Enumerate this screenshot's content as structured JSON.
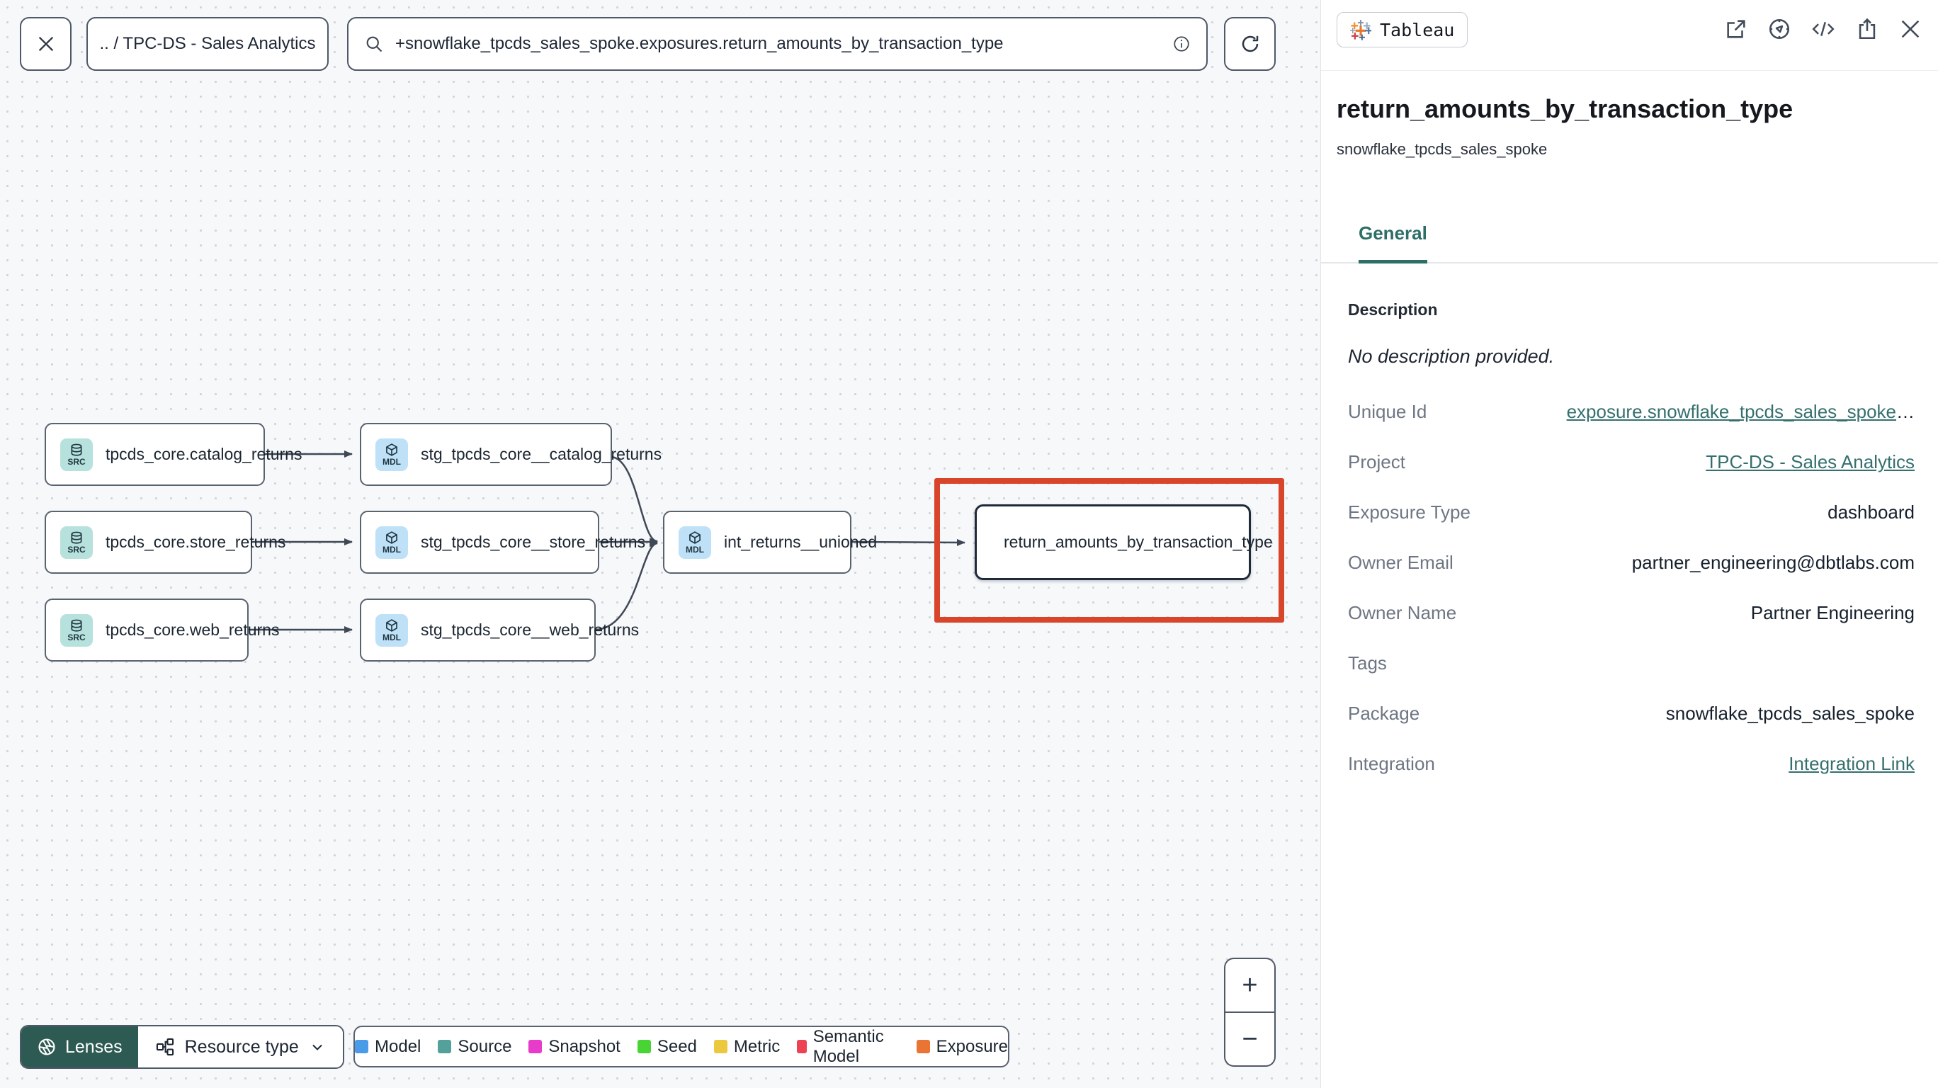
{
  "toolbar": {
    "breadcrumb": ".. / TPC-DS - Sales Analytics",
    "search_value": "+snowflake_tpcds_sales_spoke.exposures.return_amounts_by_transaction_type"
  },
  "graph": {
    "nodes": [
      {
        "badge": "SRC",
        "label": "tpcds_core.catalog_returns"
      },
      {
        "badge": "SRC",
        "label": "tpcds_core.store_returns"
      },
      {
        "badge": "SRC",
        "label": "tpcds_core.web_returns"
      },
      {
        "badge": "MDL",
        "label": "stg_tpcds_core__catalog_returns"
      },
      {
        "badge": "MDL",
        "label": "stg_tpcds_core__store_returns"
      },
      {
        "badge": "MDL",
        "label": "stg_tpcds_core__web_returns"
      },
      {
        "badge": "MDL",
        "label": "int_returns__unioned"
      },
      {
        "badge": "tableau",
        "label": "return_amounts_by_transaction_type"
      }
    ]
  },
  "controls": {
    "lenses_label": "Lenses",
    "resource_type_label": "Resource type",
    "zoom_in": "+",
    "zoom_out": "−"
  },
  "legend": {
    "items": [
      {
        "label": "Model",
        "color": "#4a9be8"
      },
      {
        "label": "Source",
        "color": "#54a09a"
      },
      {
        "label": "Snapshot",
        "color": "#e93bc9"
      },
      {
        "label": "Seed",
        "color": "#49d435"
      },
      {
        "label": "Metric",
        "color": "#ecc83f"
      },
      {
        "label": "Semantic Model",
        "color": "#ed4154"
      },
      {
        "label": "Exposure",
        "color": "#ea7434"
      }
    ]
  },
  "panel": {
    "source_chip": "Tableau",
    "title": "return_amounts_by_transaction_type",
    "subtitle": "snowflake_tpcds_sales_spoke",
    "tab_general": "General",
    "description_heading": "Description",
    "description_empty": "No description provided.",
    "fields": [
      {
        "label": "Unique Id",
        "value": "exposure.snowflake_tpcds_sales_spoke",
        "ellipsis": "…"
      },
      {
        "label": "Project",
        "value": "TPC-DS - Sales Analytics"
      },
      {
        "label": "Exposure Type",
        "value": "dashboard"
      },
      {
        "label": "Owner Email",
        "value": "partner_engineering@dbtlabs.com"
      },
      {
        "label": "Owner Name",
        "value": "Partner Engineering"
      },
      {
        "label": "Tags",
        "value": ""
      },
      {
        "label": "Package",
        "value": "snowflake_tpcds_sales_spoke"
      },
      {
        "label": "Integration",
        "value": "Integration Link"
      }
    ]
  },
  "colors": {
    "accent_teal": "#2d6e68",
    "link_teal": "#35706e",
    "highlight_red": "#d9452b",
    "lenses_bg": "#2d5a53"
  }
}
